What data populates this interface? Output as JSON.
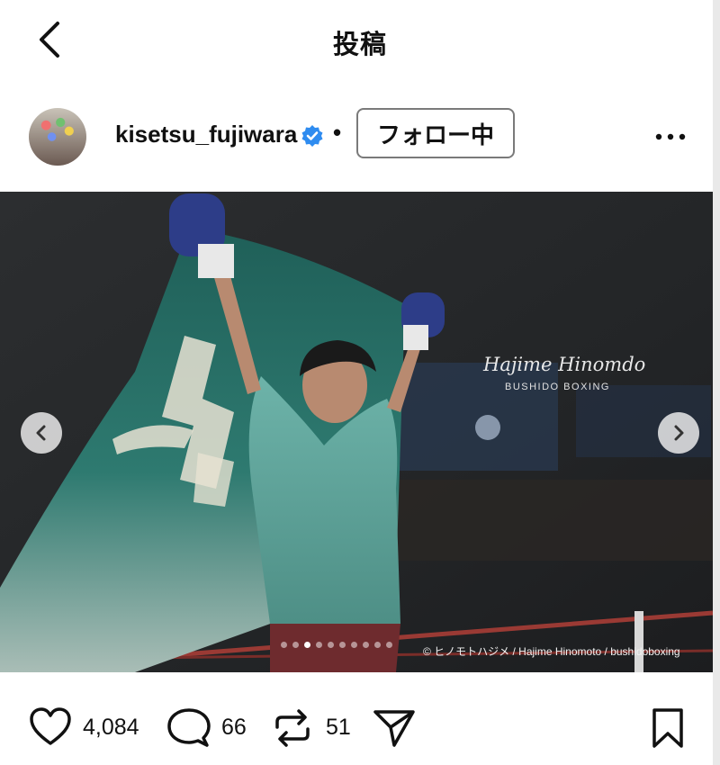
{
  "header": {
    "title": "投稿"
  },
  "post": {
    "username": "kisetsu_fujiwara",
    "separator": "•",
    "follow_label": "フォロー中"
  },
  "photo": {
    "signature": "Hajime Hinomdo",
    "signature_sub": "BUSHIDO BOXING",
    "credit": "© ヒノモトハジメ / Hajime Hinomoto / bushidoboxing",
    "carousel": {
      "total": 10,
      "active": 3
    }
  },
  "actions": {
    "likes": "4,084",
    "comments": "66",
    "reposts": "51"
  },
  "icons": [
    "back-icon",
    "verified-badge-icon",
    "more-icon",
    "chevron-left-icon",
    "chevron-right-icon",
    "heart-icon",
    "comment-icon",
    "repost-icon",
    "send-icon",
    "bookmark-icon"
  ],
  "colors": {
    "verified": "#2f8cf0",
    "flag": "#2e7a70",
    "shirt": "#5fa69d"
  }
}
